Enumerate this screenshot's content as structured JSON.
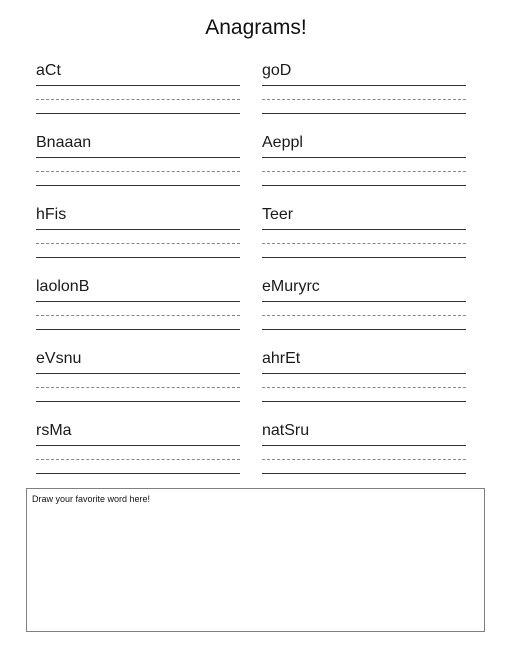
{
  "title": "Anagrams!",
  "words": [
    "aCt",
    "goD",
    "Bnaaan",
    "Aeppl",
    "hFis",
    "Teer",
    "laolonB",
    "eMuryrc",
    "eVsnu",
    "ahrEt",
    "rsMa",
    "natSru"
  ],
  "draw_box": {
    "label": "Draw your favorite word here!"
  }
}
